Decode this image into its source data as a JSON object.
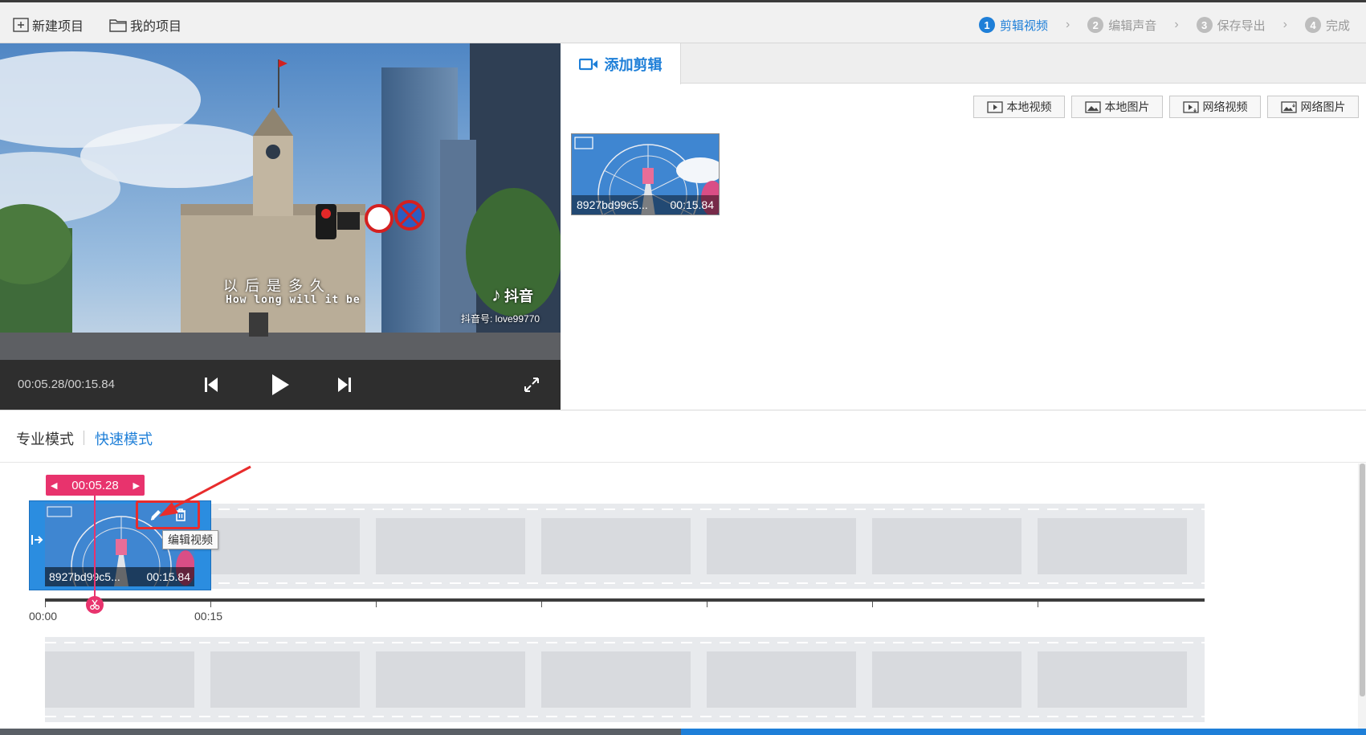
{
  "toolbar": {
    "new_project": "新建项目",
    "my_projects": "我的项目"
  },
  "steps": [
    {
      "num": "1",
      "label": "剪辑视频",
      "active": true
    },
    {
      "num": "2",
      "label": "编辑声音",
      "active": false
    },
    {
      "num": "3",
      "label": "保存导出",
      "active": false
    },
    {
      "num": "4",
      "label": "完成",
      "active": false
    }
  ],
  "player": {
    "timecode": "00:05.28/00:15.84",
    "subtitle_cn": "以 后 是 多 久",
    "subtitle_en": "How long will it be",
    "watermark_brand": "抖音",
    "watermark_id": "抖音号: love99770"
  },
  "panel": {
    "tab_label": "添加剪辑",
    "sources": [
      "本地视频",
      "本地图片",
      "网络视频",
      "网络图片"
    ],
    "clip": {
      "name": "8927bd99c5...",
      "duration": "00:15.84"
    }
  },
  "modes": {
    "pro": "专业模式",
    "quick": "快速模式",
    "active": "quick"
  },
  "timeline": {
    "playhead_time": "00:05.28",
    "clip": {
      "name": "8927bd99c5...",
      "duration": "00:15.84"
    },
    "tooltip": "编辑视频",
    "ticks": [
      "00:00",
      "00:15"
    ]
  },
  "colors": {
    "accent": "#1e7fd8",
    "playhead": "#e8336d",
    "highlight": "#e82c2c"
  }
}
